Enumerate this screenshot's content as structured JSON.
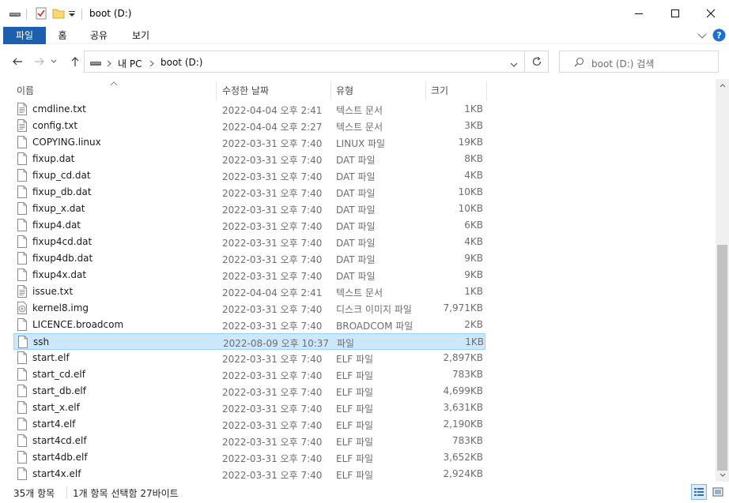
{
  "window": {
    "title": "boot (D:)"
  },
  "ribbon": {
    "tabs": [
      "파일",
      "홈",
      "공유",
      "보기"
    ]
  },
  "address": {
    "crumbs": [
      "내 PC",
      "boot (D:)"
    ]
  },
  "search": {
    "placeholder": "boot (D:) 검색"
  },
  "columns": {
    "name": "이름",
    "date": "수정한 날짜",
    "type": "유형",
    "size": "크기"
  },
  "files": [
    {
      "name": "cmdline.txt",
      "date": "2022-04-04 오후 2:41",
      "type": "텍스트 문서",
      "size": "1KB",
      "icon": "text-file-icon"
    },
    {
      "name": "config.txt",
      "date": "2022-04-04 오후 2:27",
      "type": "텍스트 문서",
      "size": "3KB",
      "icon": "text-file-icon"
    },
    {
      "name": "COPYING.linux",
      "date": "2022-03-31 오후 7:40",
      "type": "LINUX 파일",
      "size": "19KB",
      "icon": "file-icon"
    },
    {
      "name": "fixup.dat",
      "date": "2022-03-31 오후 7:40",
      "type": "DAT 파일",
      "size": "8KB",
      "icon": "file-icon"
    },
    {
      "name": "fixup_cd.dat",
      "date": "2022-03-31 오후 7:40",
      "type": "DAT 파일",
      "size": "4KB",
      "icon": "file-icon"
    },
    {
      "name": "fixup_db.dat",
      "date": "2022-03-31 오후 7:40",
      "type": "DAT 파일",
      "size": "10KB",
      "icon": "file-icon"
    },
    {
      "name": "fixup_x.dat",
      "date": "2022-03-31 오후 7:40",
      "type": "DAT 파일",
      "size": "10KB",
      "icon": "file-icon"
    },
    {
      "name": "fixup4.dat",
      "date": "2022-03-31 오후 7:40",
      "type": "DAT 파일",
      "size": "6KB",
      "icon": "file-icon"
    },
    {
      "name": "fixup4cd.dat",
      "date": "2022-03-31 오후 7:40",
      "type": "DAT 파일",
      "size": "4KB",
      "icon": "file-icon"
    },
    {
      "name": "fixup4db.dat",
      "date": "2022-03-31 오후 7:40",
      "type": "DAT 파일",
      "size": "9KB",
      "icon": "file-icon"
    },
    {
      "name": "fixup4x.dat",
      "date": "2022-03-31 오후 7:40",
      "type": "DAT 파일",
      "size": "9KB",
      "icon": "file-icon"
    },
    {
      "name": "issue.txt",
      "date": "2022-04-04 오후 2:41",
      "type": "텍스트 문서",
      "size": "1KB",
      "icon": "text-file-icon"
    },
    {
      "name": "kernel8.img",
      "date": "2022-03-31 오후 7:40",
      "type": "디스크 이미지 파일",
      "size": "7,971KB",
      "icon": "disc-image-icon"
    },
    {
      "name": "LICENCE.broadcom",
      "date": "2022-03-31 오후 7:40",
      "type": "BROADCOM 파일",
      "size": "2KB",
      "icon": "file-icon"
    },
    {
      "name": "ssh",
      "date": "2022-08-09 오후 10:37",
      "type": "파일",
      "size": "1KB",
      "icon": "file-icon",
      "selected": true
    },
    {
      "name": "start.elf",
      "date": "2022-03-31 오후 7:40",
      "type": "ELF 파일",
      "size": "2,897KB",
      "icon": "file-icon"
    },
    {
      "name": "start_cd.elf",
      "date": "2022-03-31 오후 7:40",
      "type": "ELF 파일",
      "size": "783KB",
      "icon": "file-icon"
    },
    {
      "name": "start_db.elf",
      "date": "2022-03-31 오후 7:40",
      "type": "ELF 파일",
      "size": "4,699KB",
      "icon": "file-icon"
    },
    {
      "name": "start_x.elf",
      "date": "2022-03-31 오후 7:40",
      "type": "ELF 파일",
      "size": "3,631KB",
      "icon": "file-icon"
    },
    {
      "name": "start4.elf",
      "date": "2022-03-31 오후 7:40",
      "type": "ELF 파일",
      "size": "2,190KB",
      "icon": "file-icon"
    },
    {
      "name": "start4cd.elf",
      "date": "2022-03-31 오후 7:40",
      "type": "ELF 파일",
      "size": "783KB",
      "icon": "file-icon"
    },
    {
      "name": "start4db.elf",
      "date": "2022-03-31 오후 7:40",
      "type": "ELF 파일",
      "size": "3,652KB",
      "icon": "file-icon"
    },
    {
      "name": "start4x.elf",
      "date": "2022-03-31 오후 7:40",
      "type": "ELF 파일",
      "size": "2,924KB",
      "icon": "file-icon"
    }
  ],
  "status": {
    "item_count": "35개 항목",
    "selection": "1개 항목 선택함 27바이트"
  },
  "colors": {
    "accent": "#1c5fae",
    "selection_bg": "#cce8ff",
    "selection_border": "#99d1ff"
  }
}
